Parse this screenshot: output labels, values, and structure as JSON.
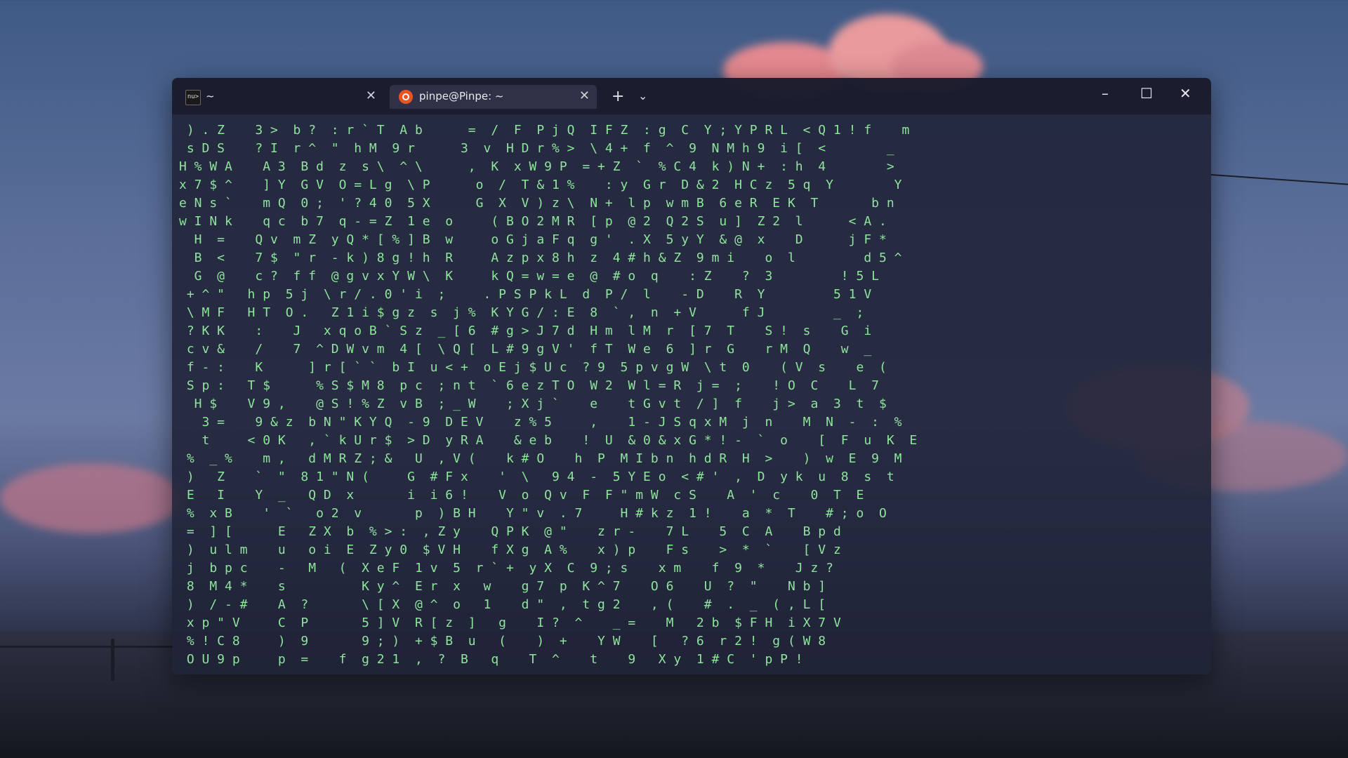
{
  "tabs": [
    {
      "label": "~",
      "icon": "nushell-icon",
      "close": "✕"
    },
    {
      "label": "pinpe@Pinpe: ~",
      "icon": "ubuntu-icon",
      "close": "✕"
    }
  ],
  "new_tab": "+",
  "dropdown": "⌄",
  "window_controls": {
    "minimize": "–",
    "maximize": "☐",
    "close": "✕"
  },
  "terminal": {
    "color": "#8fe49d",
    "lines": [
      " ) . Z    3 >  b ?  : r ` T  A b      =  /  F  P j Q  I F Z  : g  C  Y ; Y P R L  < Q 1 ! f    m",
      " s D S    ? I  r ^  \"  h M  9 r      3  v  H D r % >  \\ 4 +  f  ^  9  N M h 9  i [  <        _",
      "H % W A    A 3  B d  z  s \\  ^ \\      ,  K  x W 9 P  = + Z  `  % C 4  k ) N +  : h  4        >",
      "x 7 $ ^    ] Y  G V  O = L g  \\ P      o  /  T & 1 %    : y  G r  D & 2  H C z  5 q  Y        Y",
      "e N s `    m Q  0 ;  ' ? 4 0  5 X      G  X  V ) z \\  N +  l p  w m B  6 e R  E K  T       b n",
      "w I N k    q c  b 7  q - = Z  1 e  o     ( B O 2 M R  [ p  @ 2  Q 2 S  u ]  Z 2  l      < A .",
      "  H  =    Q v  m Z  y Q * [ % ] B  w     o G j a F q  g '  . X  5 y Y  & @  x    D      j F *",
      "  B  <    7 $  \" r  - k ) 8 g ! h  R     A z p x 8 h  z  4 # h & Z  9 m i    o  l         d 5 ^",
      "  G  @    c ?  f f  @ g v x Y W \\  K     k Q = w = e  @  # o  q    : Z    ?  3         ! 5 L",
      " + ^ \"   h p  5 j  \\ r / . 0 ' i  ;     . P S P k L  d  P /  l    - D    R  Y         5 1 V",
      " \\ M F   H T  O .   Z 1 i $ g z  s  j %  K Y G / : E  8  ` ,  n  + V      f J         _  ;",
      " ? K K    :    J   x q o B ` S z  _ [ 6  # g > J 7 d  H m  l M  r  [ 7  T    S !  s    G  i",
      " c v &    /    7  ^ D W v m  4 [  \\ Q [  L # 9 g V '  f T  W e  6  ] r  G    r M  Q    w  _",
      " f - :    K      ] r [ ` `  b I  u < +  o E j $ U c  ? 9  5 p v g W  \\ t  0    ( V  s    e  (",
      " S p :   T $      % S $ M 8  p c  ; n t  ` 6 e z T O  W 2  W l = R  j =  ;    ! O  C    L  7",
      "  H $    V 9 ,    @ S ! % Z  v B  ; _ W    ; X j `    e    t G v t  / ]  f    j >  a  3  t  $",
      "   3 =    9 & z  b N \" K Y Q  - 9  D E V    z % 5     ,    1 - J S q x M  j  n    M  N  -  :  %",
      "   t     < 0 K   , ` k U r $  > D  y R A    & e b    !  U  & 0 & x G * ! -  `  o    [  F  u  K  E",
      " %  _ %    m ,   d M R Z ; &   U  , V (    k # O    h  P  M I b n  h d R  H  >    )  w  E  9  M",
      " )   Z    `  \"  8 1 \" N (     G  # F x    '  \\   9 4  -  5 Y E o  < # '  ,  D  y k  u  8  s  t",
      " E   I    Y  _   Q D  x       i  i 6 !    V  o  Q v  F  F \" m W  c S    A  '  c    0  T  E",
      " %  x B    '  `   o 2  v       p  ) B H    Y \" v  . 7     H # k z  1 !    a  *  T    # ; o  O",
      " =  ] [      E   Z X  b  % > :  , Z y    Q P K  @ \"    z r -    7 L    5  C  A    B p d",
      " )  u l m    u   o i  E  Z y 0  $ V H    f X g  A %    x ) p    F s    >  *  `    [ V z",
      " j  b p c    -   M   (  X e F  1 v  5  r ` +  y X  C  9 ; s    x m    f  9  *    J z ?",
      " 8  M 4 *    s          K y ^  E r  x   w    g 7  p  K ^ 7    O 6    U  ?  \"    N b ]",
      " )  / - #    A  ?       \\ [ X  @ ^  o   1    d \"  ,  t g 2    , (    #  .  _  ( , L [",
      " x p \" V     C  P       5 ] V  R [ z  ]   g    I ?  ^    _ =    M   2 b  $ F H  i X 7 V",
      " % ! C 8     )  9       9 ; )  + $ B  u   (    )  +    Y W    [   ? 6  r 2 !  g ( W 8",
      " O U 9 p     p  =    f  g 2 1  ,  ?  B   q    T  ^    t    9   X y  1 # C  ' p P !"
    ]
  }
}
